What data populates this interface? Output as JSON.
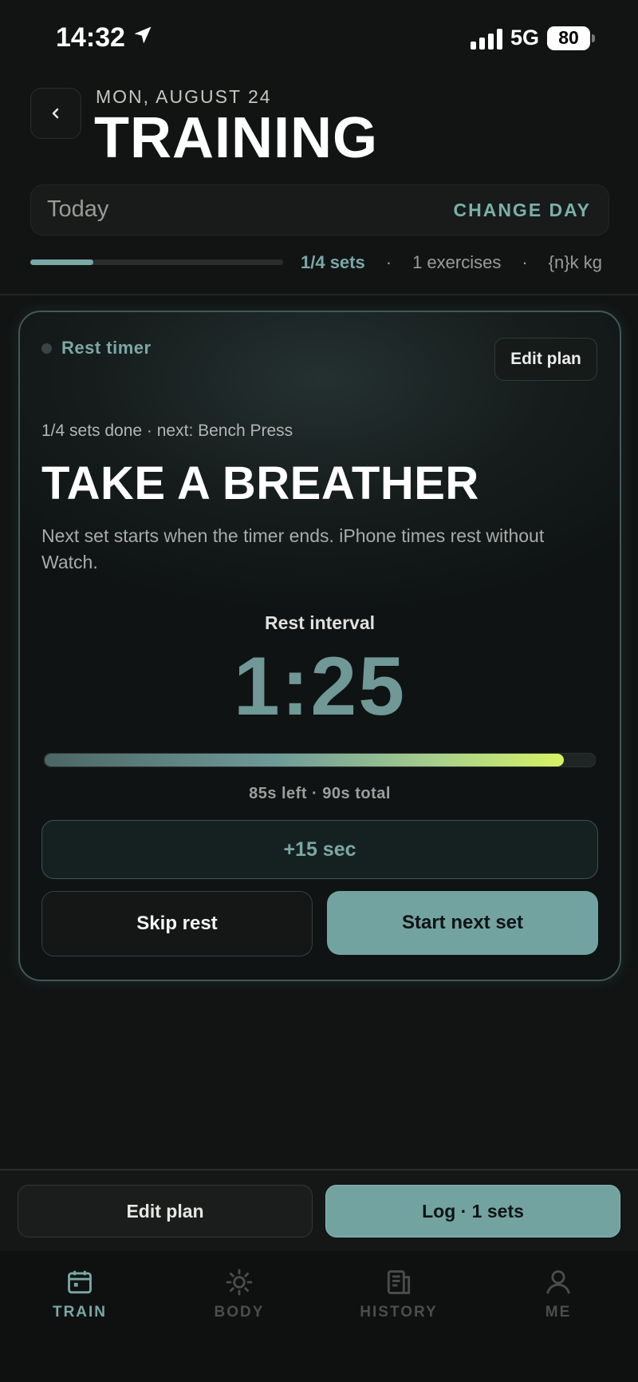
{
  "status_bar": {
    "time": "14:32",
    "network": "5G",
    "battery": "80"
  },
  "header": {
    "date": "MON, AUGUST 24",
    "title": "TRAINING"
  },
  "day_selector": {
    "value": "Today",
    "action": "CHANGE DAY"
  },
  "summary": {
    "progress": 0.25,
    "sets": "1/4 sets",
    "sep": "·",
    "exercises": "1 exercises",
    "weight": "{n}k kg"
  },
  "rest_card": {
    "badge": "Rest timer",
    "edit_label": "Edit plan",
    "sets_info": "1/4 sets done · next: Bench Press",
    "title": "TAKE A BREATHER",
    "description": "Next set starts when the timer ends. iPhone times rest without Watch.",
    "interval_label": "Rest interval",
    "countdown": "1:25",
    "progress": 0.944,
    "time_left": "85s left · 90s total",
    "add_button": "+15 sec",
    "skip_button": "Skip rest",
    "next_button": "Start next set"
  },
  "action_bar": {
    "edit_label": "Edit plan",
    "log_label": "Log · 1 sets"
  },
  "tabs": [
    {
      "label": "TRAIN",
      "icon": "calendar-icon",
      "active": true
    },
    {
      "label": "BODY",
      "icon": "sun-icon",
      "active": false
    },
    {
      "label": "HISTORY",
      "icon": "history-icon",
      "active": false
    },
    {
      "label": "ME",
      "icon": "person-icon",
      "active": false
    }
  ],
  "colors": {
    "accent": "#7aa8a6",
    "background": "#121414",
    "inactive": "#4a4d4b"
  }
}
